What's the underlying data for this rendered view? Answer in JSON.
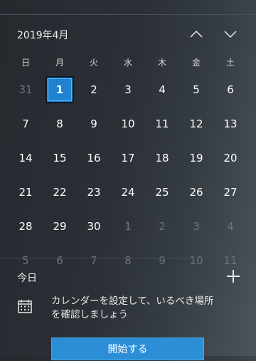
{
  "calendar": {
    "month_label": "2019年4月",
    "weekdays": [
      "日",
      "月",
      "火",
      "水",
      "木",
      "金",
      "土"
    ],
    "days": [
      {
        "label": "31",
        "other": true
      },
      {
        "label": "1",
        "today": true
      },
      {
        "label": "2"
      },
      {
        "label": "3"
      },
      {
        "label": "4"
      },
      {
        "label": "5"
      },
      {
        "label": "6"
      },
      {
        "label": "7"
      },
      {
        "label": "8"
      },
      {
        "label": "9"
      },
      {
        "label": "10"
      },
      {
        "label": "11"
      },
      {
        "label": "12"
      },
      {
        "label": "13"
      },
      {
        "label": "14"
      },
      {
        "label": "15"
      },
      {
        "label": "16"
      },
      {
        "label": "17"
      },
      {
        "label": "18"
      },
      {
        "label": "19"
      },
      {
        "label": "20"
      },
      {
        "label": "21"
      },
      {
        "label": "22"
      },
      {
        "label": "23"
      },
      {
        "label": "24"
      },
      {
        "label": "25"
      },
      {
        "label": "26"
      },
      {
        "label": "27"
      },
      {
        "label": "28"
      },
      {
        "label": "29"
      },
      {
        "label": "30"
      },
      {
        "label": "1",
        "other": true
      },
      {
        "label": "2",
        "other": true
      },
      {
        "label": "3",
        "other": true
      },
      {
        "label": "4",
        "other": true
      },
      {
        "label": "5",
        "other": true
      },
      {
        "label": "6",
        "other": true
      },
      {
        "label": "7",
        "other": true
      },
      {
        "label": "8",
        "other": true
      },
      {
        "label": "9",
        "other": true
      },
      {
        "label": "10",
        "other": true
      },
      {
        "label": "11",
        "other": true
      }
    ]
  },
  "agenda": {
    "title": "今日",
    "setup_text": "カレンダーを設定して、いるべき場所を確認しましょう",
    "start_button_label": "開始する"
  },
  "colors": {
    "accent": "#2d8ed8",
    "today_fill": "#1f83cf",
    "muted_day": "#6d757b"
  },
  "icons": {
    "previous_month": "chevron-up-icon",
    "next_month": "chevron-down-icon",
    "add_event": "plus-icon",
    "calendar": "calendar-icon"
  }
}
